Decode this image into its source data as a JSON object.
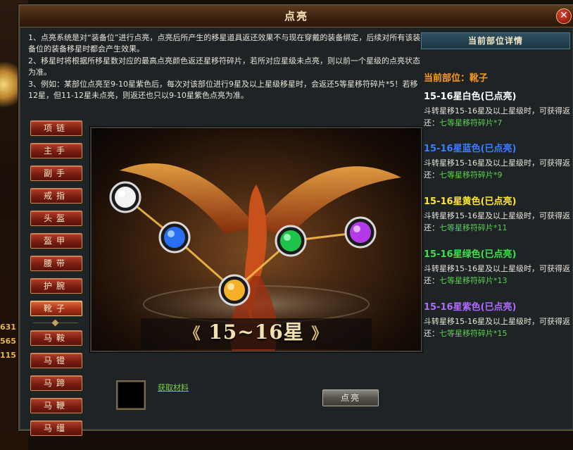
{
  "side_numbers": [
    "631",
    "565",
    "115"
  ],
  "dialog": {
    "title": "点亮",
    "close_label": "✕"
  },
  "description": [
    "1、点亮系统是对“装备位”进行点亮，点亮后所产生的移星道具返还效果不与现在穿戴的装备绑定，后续对所有该装备位的装备移星时都会产生效果。",
    "2、移星时将根据所移星数对应的最高点亮颜色返还星移符碎片，若所对应星级未点亮，则以前一个星级的点亮状态为准。",
    "3、例如：某部位点亮至9-10星紫色后，每次对该部位进行9星及以上星级移星时，会返还5等星移符碎片*5！若移12星，但11-12星未点亮，则返还也只以9-10星紫色点亮为准。"
  ],
  "slots": [
    "项链",
    "主手",
    "副手",
    "戒指",
    "头盔",
    "盔甲",
    "腰带",
    "护腕",
    "靴子",
    "马鞍",
    "马镫",
    "马蹄",
    "马鞭",
    "马缰"
  ],
  "active_slot": "靴子",
  "banner": {
    "left_arrow": "《",
    "label": "15~16星",
    "right_arrow": "》"
  },
  "orbs": [
    {
      "name": "white",
      "color": "#f2f2f2"
    },
    {
      "name": "blue",
      "color": "#2a6ef0"
    },
    {
      "name": "yellow",
      "color": "#f5b12a"
    },
    {
      "name": "green",
      "color": "#1ec34a"
    },
    {
      "name": "purple",
      "color": "#b23ae8"
    }
  ],
  "bottom": {
    "get_material": "获取材料",
    "light_button": "点亮"
  },
  "detail": {
    "header": "当前部位详情",
    "current_part": "当前部位：靴子",
    "tiers": [
      {
        "name": "15-16星白色(已点亮)",
        "color": "#ffffff",
        "desc": "斗转星移15-16星及以上星级时，可获得返还：",
        "reward": "七等星移符碎片*7"
      },
      {
        "name": "15-16星蓝色(已点亮)",
        "color": "#3d7bff",
        "desc": "斗转星移15-16星及以上星级时，可获得返还：",
        "reward": "七等星移符碎片*9"
      },
      {
        "name": "15-16星黄色(已点亮)",
        "color": "#ffe43a",
        "desc": "斗转星移15-16星及以上星级时，可获得返还：",
        "reward": "七等星移符碎片*11"
      },
      {
        "name": "15-16星绿色(已点亮)",
        "color": "#3ee04a",
        "desc": "斗转星移15-16星及以上星级时，可获得返还：",
        "reward": "七等星移符碎片*13"
      },
      {
        "name": "15-16星紫色(已点亮)",
        "color": "#b06aff",
        "desc": "斗转星移15-16星及以上星级时，可获得返还：",
        "reward": "七等星移符碎片*15"
      }
    ]
  }
}
